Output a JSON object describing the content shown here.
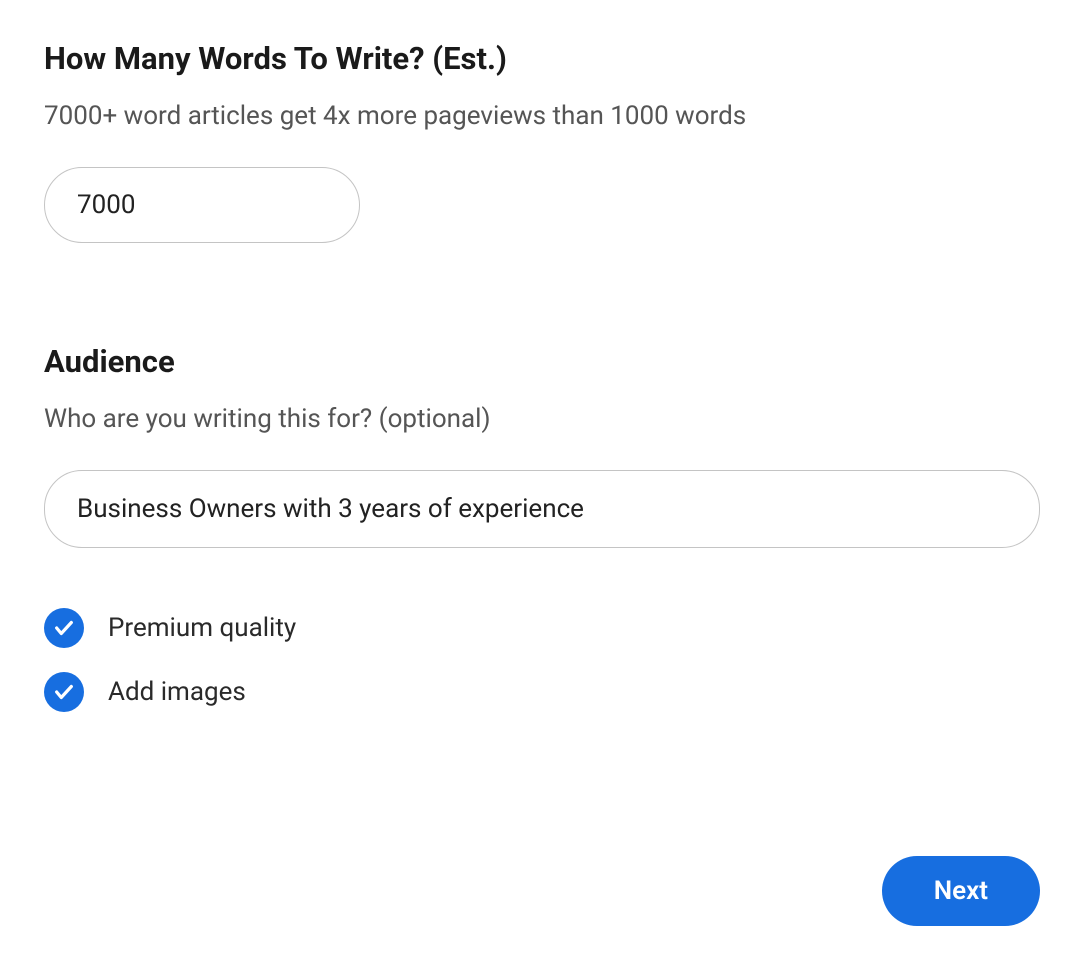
{
  "wordcount": {
    "title": "How Many Words To Write? (Est.)",
    "subtitle": "7000+ word articles get 4x more pageviews than 1000 words",
    "value": "7000"
  },
  "audience": {
    "title": "Audience",
    "subtitle": "Who are you writing this for? (optional)",
    "value": "Business Owners with 3 years of experience"
  },
  "options": {
    "premium_quality": {
      "label": "Premium quality",
      "checked": true
    },
    "add_images": {
      "label": "Add images",
      "checked": true
    }
  },
  "actions": {
    "next_label": "Next"
  },
  "colors": {
    "accent": "#176ee0"
  }
}
